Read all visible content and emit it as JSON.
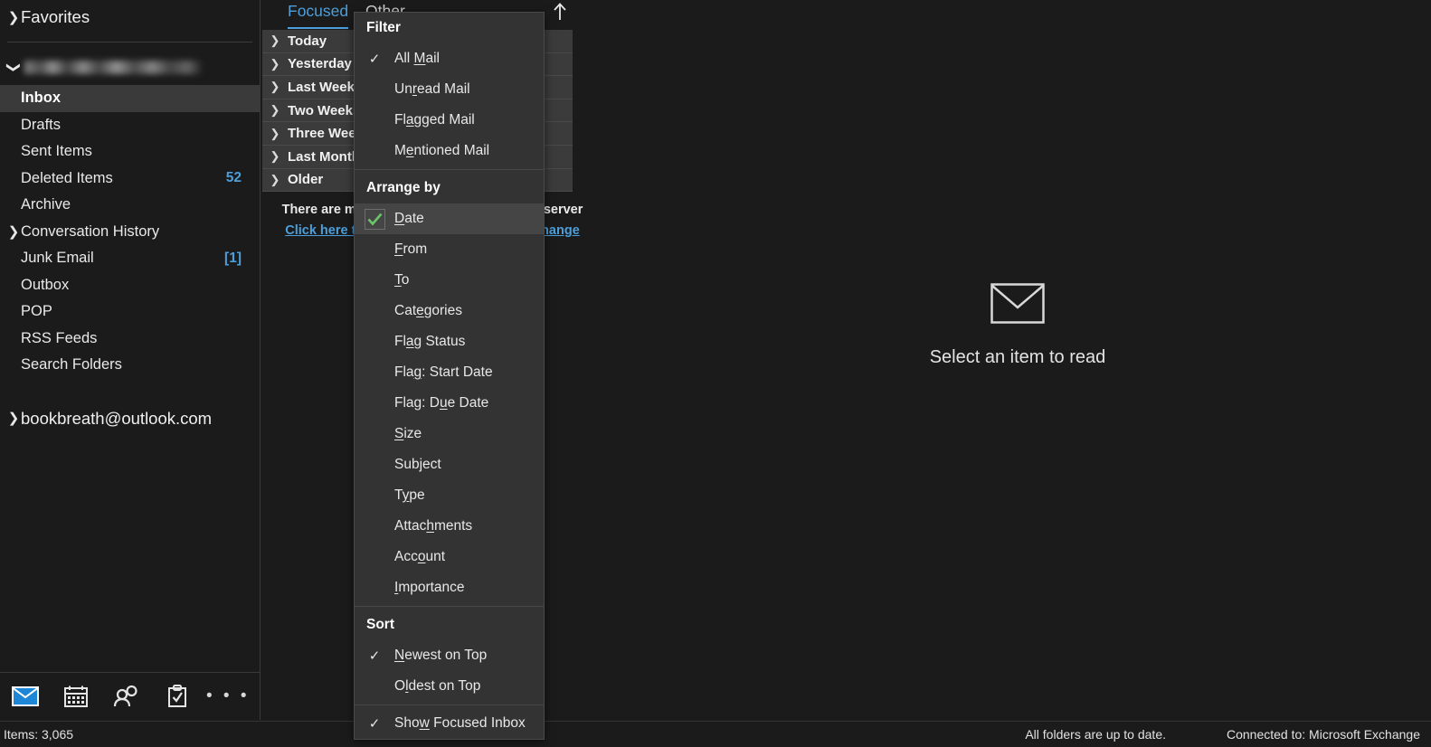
{
  "sidebar": {
    "favorites_label": "Favorites",
    "account_primary_masked": "",
    "folders": [
      {
        "label": "Inbox",
        "count": "",
        "selected": true,
        "expandable": false
      },
      {
        "label": "Drafts",
        "count": "",
        "selected": false,
        "expandable": false
      },
      {
        "label": "Sent Items",
        "count": "",
        "selected": false,
        "expandable": false
      },
      {
        "label": "Deleted Items",
        "count": "52",
        "selected": false,
        "expandable": false
      },
      {
        "label": "Archive",
        "count": "",
        "selected": false,
        "expandable": false
      },
      {
        "label": "Conversation History",
        "count": "",
        "selected": false,
        "expandable": true
      },
      {
        "label": "Junk Email",
        "count": "[1]",
        "selected": false,
        "expandable": false
      },
      {
        "label": "Outbox",
        "count": "",
        "selected": false,
        "expandable": false
      },
      {
        "label": "POP",
        "count": "",
        "selected": false,
        "expandable": false
      },
      {
        "label": "RSS Feeds",
        "count": "",
        "selected": false,
        "expandable": false
      },
      {
        "label": "Search Folders",
        "count": "",
        "selected": false,
        "expandable": false
      }
    ],
    "account_secondary": "bookbreath@outlook.com"
  },
  "navbar": {
    "items": [
      {
        "icon": "mail-icon",
        "label": "Mail",
        "active": true
      },
      {
        "icon": "calendar-icon",
        "label": "Calendar",
        "active": false
      },
      {
        "icon": "people-icon",
        "label": "People",
        "active": false
      },
      {
        "icon": "tasks-icon",
        "label": "Tasks",
        "active": false
      },
      {
        "icon": "more-icon",
        "label": "More",
        "active": false
      }
    ],
    "more_glyph": "• • •"
  },
  "list": {
    "tab_focused": "Focused",
    "tab_other": "Other",
    "sort_arrow_icon": "arrow-up-icon",
    "groups": [
      {
        "label": "Today"
      },
      {
        "label": "Yesterday"
      },
      {
        "label": "Last Week"
      },
      {
        "label": "Two Weeks Ago"
      },
      {
        "label": "Three Weeks Ago"
      },
      {
        "label": "Last Month"
      },
      {
        "label": "Older"
      }
    ],
    "more_items_text": "There are more items in this folder on the server",
    "more_items_link": "Click here to view more on Microsoft Exchange"
  },
  "reading_pane": {
    "empty_icon": "envelope-icon",
    "empty_text": "Select an item to read"
  },
  "menu": {
    "filter_header": "Filter",
    "filter_items": [
      {
        "label": "All Mail",
        "accel_index": 4,
        "checked": true
      },
      {
        "label": "Unread Mail",
        "accel_index": 2,
        "checked": false
      },
      {
        "label": "Flagged Mail",
        "accel_index": 2,
        "checked": false
      },
      {
        "label": "Mentioned Mail",
        "accel_index": 1,
        "checked": false
      }
    ],
    "arrange_header": "Arrange by",
    "arrange_items": [
      {
        "label": "Date",
        "accel_index": 0,
        "checked": true,
        "highlight": true
      },
      {
        "label": "From",
        "accel_index": 0,
        "checked": false,
        "highlight": false
      },
      {
        "label": "To",
        "accel_index": 0,
        "checked": false,
        "highlight": false
      },
      {
        "label": "Categories",
        "accel_index": 3,
        "checked": false,
        "highlight": false
      },
      {
        "label": "Flag Status",
        "accel_index": 2,
        "checked": false,
        "highlight": false
      },
      {
        "label": "Flag: Start Date",
        "accel_index": 3,
        "checked": false,
        "highlight": false
      },
      {
        "label": "Flag: Due Date",
        "accel_index": 7,
        "checked": false,
        "highlight": false
      },
      {
        "label": "Size",
        "accel_index": 0,
        "checked": false,
        "highlight": false
      },
      {
        "label": "Subject",
        "accel_index": 3,
        "checked": false,
        "highlight": false
      },
      {
        "label": "Type",
        "accel_index": 1,
        "checked": false,
        "highlight": false
      },
      {
        "label": "Attachments",
        "accel_index": 5,
        "checked": false,
        "highlight": false
      },
      {
        "label": "Account",
        "accel_index": 3,
        "checked": false,
        "highlight": false
      },
      {
        "label": "Importance",
        "accel_index": 0,
        "checked": false,
        "highlight": false
      }
    ],
    "sort_header": "Sort",
    "sort_items": [
      {
        "label": "Newest on Top",
        "accel_index": 0,
        "checked": true
      },
      {
        "label": "Oldest on Top",
        "accel_index": 1,
        "checked": false
      }
    ],
    "focused_inbox_item": {
      "label": "Show Focused Inbox",
      "accel_index": 3,
      "checked": true
    },
    "checkmark_glyph": "✓",
    "green_check_color": "#6cc46c"
  },
  "statusbar": {
    "items_count": "Items: 3,065",
    "sync_status": "All folders are up to date.",
    "connection": "Connected to: Microsoft Exchange"
  },
  "colors": {
    "app_bg": "#1b1b1b",
    "menu_bg": "#333333",
    "menu_highlight": "#454545",
    "group_row_bg": "#3b3b3b",
    "accent_blue": "#4c9fdb",
    "selected_folder_bg": "#3a3a3a"
  }
}
